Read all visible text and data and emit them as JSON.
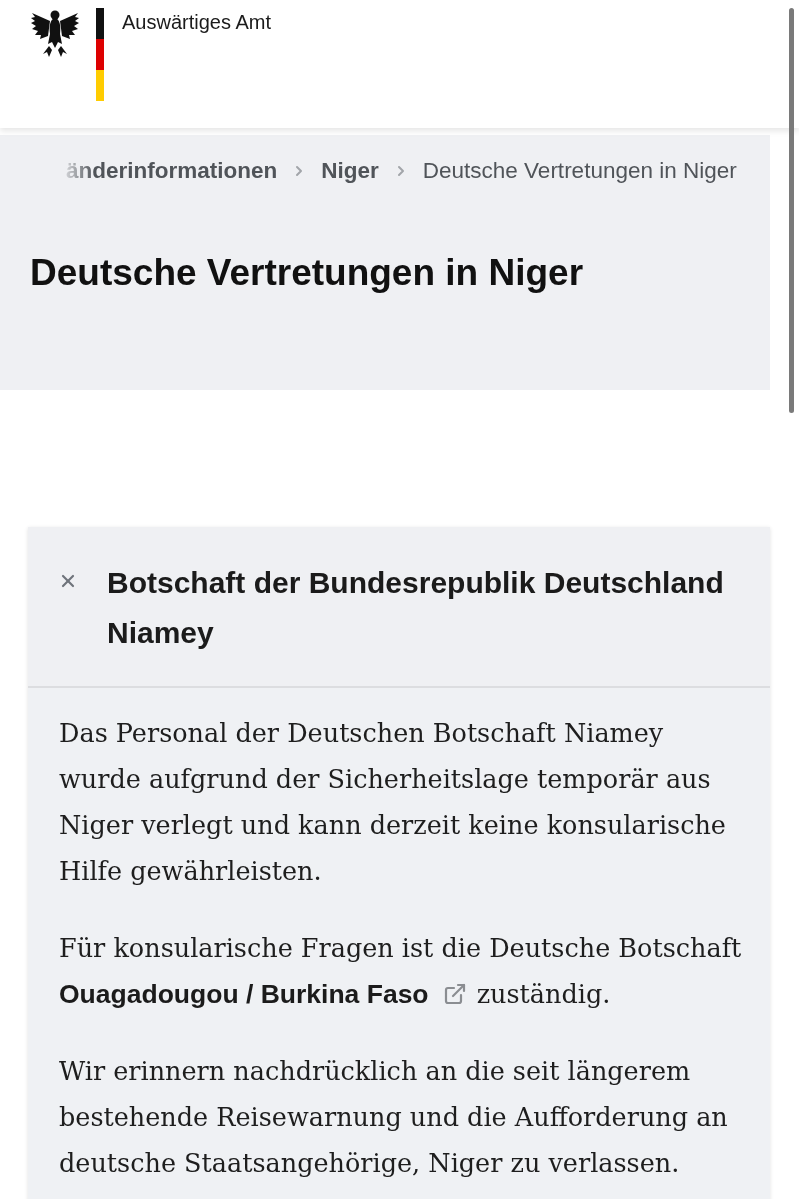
{
  "header": {
    "title": "Auswärtiges Amt"
  },
  "breadcrumb": [
    {
      "label": "änderinformationen",
      "current": false
    },
    {
      "label": "Niger",
      "current": false
    },
    {
      "label": "Deutsche Vertretungen in Niger",
      "current": true
    }
  ],
  "page_title": "Deutsche Vertretungen in Niger",
  "accordion": {
    "title": "Botschaft der Bundesrepublik Deutschland Niamey",
    "expanded": true,
    "paragraphs": [
      [
        {
          "kind": "text",
          "text": "Das Personal der Deutschen Botschaft Niamey wurde aufgrund der Sicherheitslage temporär aus Niger verlegt und kann derzeit keine konsularische Hilfe gewährleisten."
        }
      ],
      [
        {
          "kind": "text",
          "text": "Für konsularische Fragen ist die Deutsche Botschaft "
        },
        {
          "kind": "link",
          "text": "Ouagadougou / Burkina Faso",
          "external": true
        },
        {
          "kind": "text",
          "text": " zuständig."
        }
      ],
      [
        {
          "kind": "text",
          "text": "Wir erinnern nachdrücklich an die seit längerem bestehende Reisewarnung und die Aufforderung an deutsche Staatsangehörige, Niger zu verlassen."
        }
      ]
    ]
  }
}
